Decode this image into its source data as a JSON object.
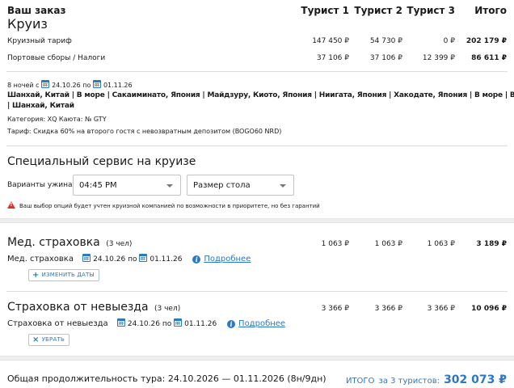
{
  "order": {
    "title": "Ваш заказ",
    "subtitle": "Круиз",
    "columns": [
      "Турист 1",
      "Турист 2",
      "Турист 3",
      "Итого"
    ]
  },
  "cruise": {
    "rows": [
      {
        "label": "Круизный тариф",
        "t1": "147 450 ₽",
        "t2": "54 730 ₽",
        "t3": "0 ₽",
        "total": "202 179 ₽"
      },
      {
        "label": "Портовые сборы / Налоги",
        "t1": "37 106 ₽",
        "t2": "37 106 ₽",
        "t3": "12 399 ₽",
        "total": "86 611 ₽"
      }
    ],
    "nights": "8 ночей с",
    "date_from": "24.10.26",
    "date_sep": "по",
    "date_to": "01.11.26",
    "itinerary_line1": "Шанхай, Китай | В море | Сакаиминато, Япония | Майдзуру, Киото, Япония | Ниигата, Япония | Хакодате, Япония | В море | В море",
    "itinerary_line2": "| Шанхай, Китай",
    "category": "Категория: XQ   Каюта: № GTY",
    "tariff": "Тариф: Скидка 60% на второго гостя с невозвратным депозитом (BOGO60 NRD)"
  },
  "special_service": {
    "title": "Специальный сервис на круизе",
    "dinner_label": "Варианты ужина",
    "dinner_value": "04:45 PM",
    "table_size_value": "Размер стола",
    "warning": "Ваш выбор опций будет учтен круизной компанией по возможности в приоритете, но без гарантий"
  },
  "med_insurance": {
    "title": "Мед. страховка",
    "people": "(3 чел)",
    "t1": "1 063 ₽",
    "t2": "1 063 ₽",
    "t3": "1 063 ₽",
    "total": "3 189 ₽",
    "line_label": "Мед. страховка",
    "date_from": "24.10.26",
    "date_sep": "по",
    "date_to": "01.11.26",
    "more": "Подробнее",
    "button": "ИЗМЕНИТЬ ДАТЫ"
  },
  "cancel_insurance": {
    "title": "Страховка от невыезда",
    "people": "(3 чел)",
    "t1": "3 366 ₽",
    "t2": "3 366 ₽",
    "t3": "3 366 ₽",
    "total": "10 096 ₽",
    "line_label": "Страховка от невыезда",
    "date_from": "24.10.26",
    "date_sep": "по",
    "date_to": "01.11.26",
    "more": "Подробнее",
    "button": "УБРАТЬ"
  },
  "footer": {
    "duration": "Общая продолжительность тура: 24.10.2026 — 01.11.2026 (8н/9дн)",
    "total_label": "ИТОГО",
    "total_small": "за 3 туристов:",
    "total_value": "302 073 ₽"
  },
  "colors": {
    "accent": "#2a78c6",
    "warning": "#d9342b"
  }
}
